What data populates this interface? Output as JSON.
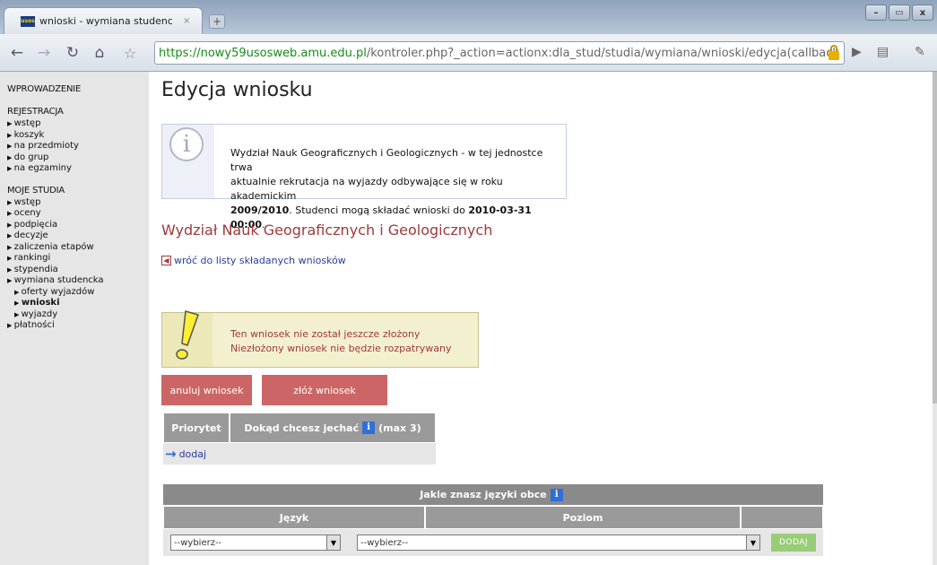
{
  "browser": {
    "tab_title": "wnioski - wymiana studenc…",
    "tab_close": "×",
    "new_tab": "+",
    "favicon_text": "usos",
    "url_https": "https://",
    "url_domain": "nowy59usosweb.amu.edu.pl",
    "url_path": "/kontroler.php?_action=actionx:dla_stud/studia/wymiana/wnioski/edycja(callback",
    "window_buttons": [
      "–",
      "▭",
      "x"
    ]
  },
  "sidebar": {
    "intro": "WPROWADZENIE",
    "sections": [
      {
        "title": "REJESTRACJA",
        "items": [
          "wstęp",
          "koszyk",
          "na przedmioty",
          "do grup",
          "na egzaminy"
        ]
      },
      {
        "title": "MOJE STUDIA",
        "items": [
          "wstęp",
          "oceny",
          "podpięcia",
          "decyzje",
          "zaliczenia etapów",
          "rankingi",
          "stypendia",
          "wymiana studencka"
        ],
        "subitems": [
          "oferty wyjazdów",
          "wnioski",
          "wyjazdy"
        ],
        "after": [
          "płatności"
        ]
      }
    ]
  },
  "main": {
    "title": "Edycja wniosku",
    "info": {
      "line1": "Wydział Nauk Geograficznych i Geologicznych - w tej jednostce trwa",
      "line2": "aktualnie rekrutacja na wyjazdy odbywające się w roku akademickim",
      "year": "2009/2010",
      "mid": ". Studenci mogą składać wnioski do ",
      "deadline": "2010-03-31 00:00",
      "end": "."
    },
    "faculty": "Wydział Nauk Geograficznych i Geologicznych",
    "back_link": "wróć do listy składanych wniosków",
    "warning": {
      "line1": "Ten wniosek nie został jeszcze złożony",
      "line2": "Niezłożony wniosek nie będzie rozpatrywany"
    },
    "btn_cancel": "anuluj wniosek",
    "btn_submit": "złóż wniosek",
    "priority_table": {
      "col1": "Priorytet",
      "col2": "Dokąd chcesz jechać",
      "col2_suffix": "(max 3)",
      "add": "dodaj"
    },
    "language_table": {
      "title": "Jakie znasz języki obce",
      "col_lang": "Język",
      "col_level": "Poziom",
      "select_lang": "--wybierz--",
      "select_level": "--wybierz--",
      "add_btn": "DODAJ"
    }
  }
}
